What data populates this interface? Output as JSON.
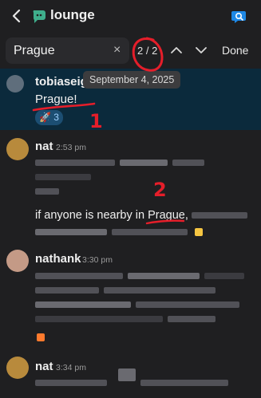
{
  "header": {
    "title": "lounge",
    "back_icon": "chevron-left-icon",
    "channel_icon": "chat-bubble-icon",
    "search_icon": "search-chat-icon"
  },
  "search": {
    "query": "Prague",
    "counter": "2 / 2",
    "done_label": "Done",
    "clear_icon": "×"
  },
  "messages": [
    {
      "author": "tobiaseig",
      "tooltip": "September 4, 2025",
      "text": "Prague!",
      "reaction": {
        "emoji": "🚀",
        "count": "3"
      }
    },
    {
      "author": "nat",
      "time": "2:53 pm",
      "text_visible_prefix": "if anyone is nearby in ",
      "text_match": "Prague",
      "text_after": ","
    },
    {
      "author": "nathank",
      "time": "3:30 pm"
    },
    {
      "author": "nat",
      "time": "3:34 pm"
    }
  ],
  "annotations": {
    "mark_1": "1",
    "mark_2": "2"
  },
  "colors": {
    "background": "#1f1f21",
    "highlight_row": "#0b2a3c",
    "annotation_red": "#e51e2a",
    "reaction_bg": "#1c4e72"
  }
}
